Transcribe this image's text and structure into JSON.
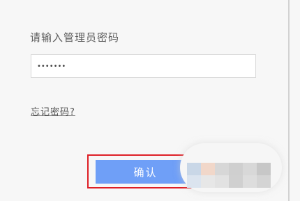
{
  "login": {
    "title": "请输入管理员密码",
    "password_value": "•••••••",
    "forgot_link": "忘记密码?",
    "confirm_button": "确认"
  },
  "colors": {
    "confirm_button_bg": "#6f9ff7",
    "highlight_border": "#de1f26",
    "page_bg": "#f7f7f7"
  }
}
